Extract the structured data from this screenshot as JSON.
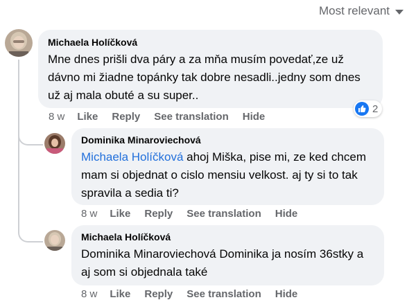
{
  "sort": {
    "label": "Most relevant"
  },
  "comments": [
    {
      "author": "Michaela Holíčková",
      "text": "Mne dnes prišli dva páry a za mňa musím povedať,ze už dávno mi žiadne topánky tak dobre nesadli..jedny som dnes už aj mala obuté a su super..",
      "time": "8 w",
      "like": "Like",
      "reply": "Reply",
      "translate": "See translation",
      "hide": "Hide",
      "reaction_count": "2"
    },
    {
      "author": "Dominika Minaroviechová",
      "mention": "Michaela Holíčková",
      "text": " ahoj Miška, pise mi, ze ked chcem mam si objednat o cislo mensiu velkost. aj ty si to tak spravila a sedia ti?",
      "time": "8 w",
      "like": "Like",
      "reply": "Reply",
      "translate": "See translation",
      "hide": "Hide"
    },
    {
      "author": "Michaela Holíčková",
      "text": "Dominika Minaroviechová Dominika ja nosím 36stky a aj som si objednala také",
      "time": "8 w",
      "like": "Like",
      "reply": "Reply",
      "translate": "See translation",
      "hide": "Hide"
    }
  ],
  "colors": {
    "bubble": "#f0f2f5",
    "mention": "#216fdb",
    "meta": "#65676b",
    "like": "#1877f2"
  }
}
